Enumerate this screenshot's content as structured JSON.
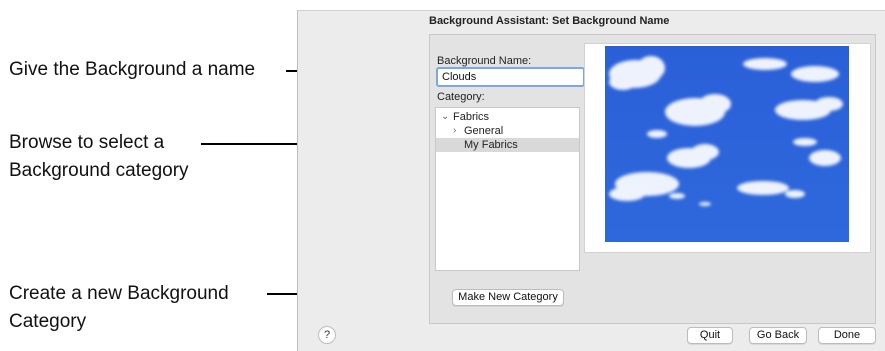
{
  "callouts": {
    "name": "Give the Background a name",
    "browse_line1": "Browse to select a",
    "browse_line2": "Background category",
    "create_line1": "Create a new Background",
    "create_line2": "Category"
  },
  "dialog": {
    "title": "Background Assistant: Set Background Name",
    "name_label": "Background Name:",
    "name_value": "Clouds",
    "category_label": "Category:",
    "tree": [
      {
        "label": "Fabrics",
        "state": "expanded",
        "level": 0
      },
      {
        "label": "General",
        "state": "collapsed",
        "level": 1
      },
      {
        "label": "My Fabrics",
        "state": "selected",
        "level": 1
      }
    ],
    "make_new_category": "Make New Category",
    "help": "?",
    "quit": "Quit",
    "go_back": "Go Back",
    "done": "Done"
  },
  "colors": {
    "sky": "#2f63d6",
    "input_focus": "#7aa7ea",
    "selected_row": "#d9d9d9"
  }
}
